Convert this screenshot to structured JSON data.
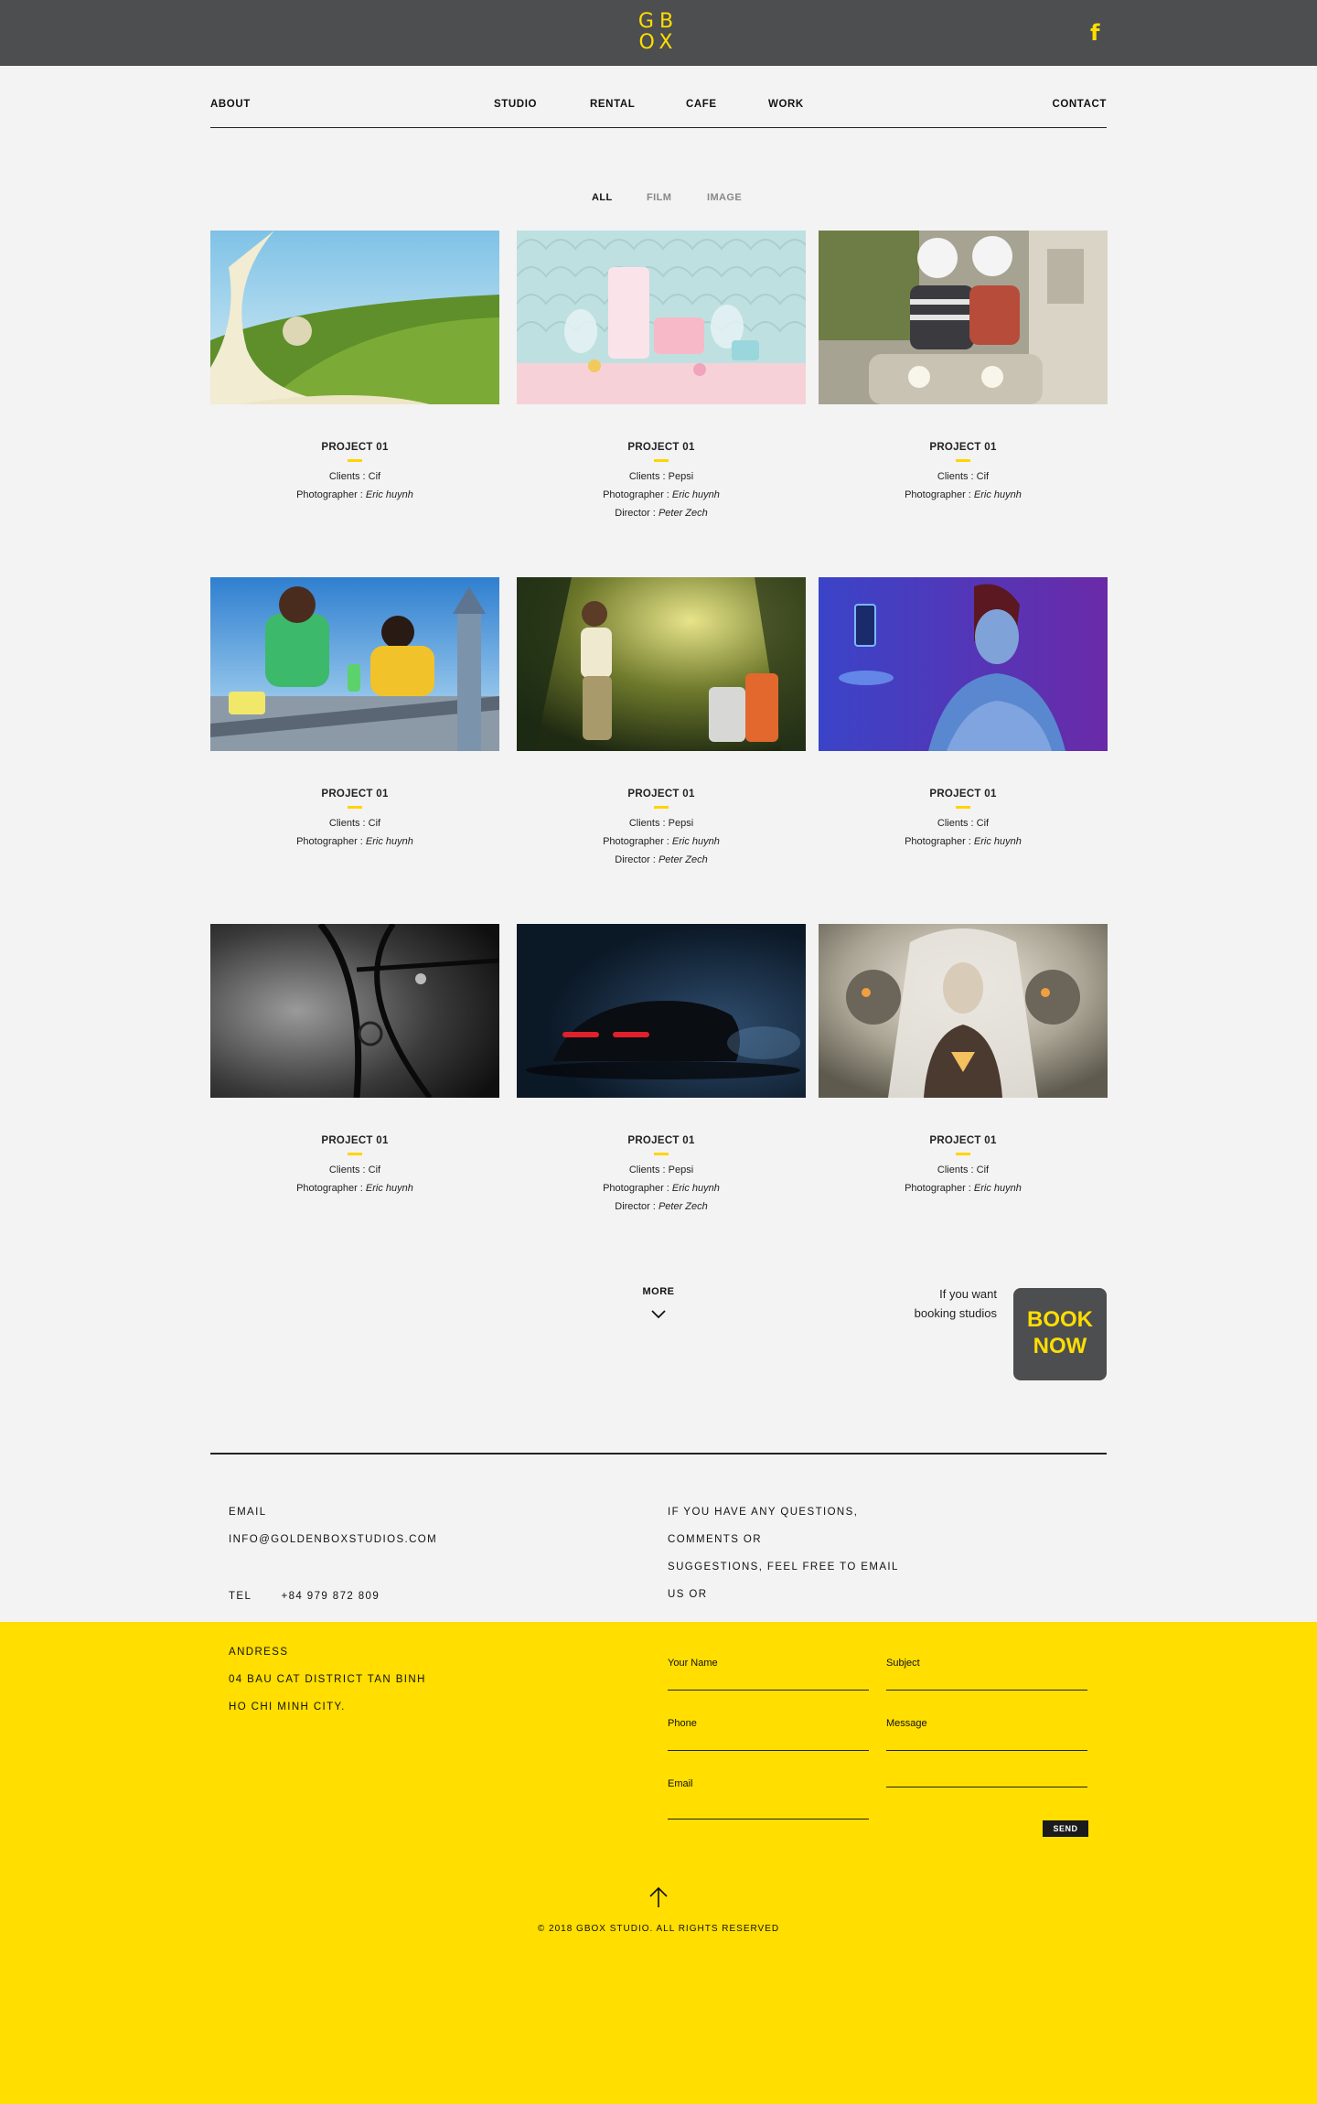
{
  "header": {
    "logo_top": "GB",
    "logo_bottom": "OX",
    "social_icon": "f"
  },
  "nav": {
    "about": "ABOUT",
    "studio": "STUDIO",
    "rental": "RENTAL",
    "cafe": "CAFE",
    "work": "WORK",
    "contact": "CONTACT"
  },
  "filters": {
    "all": "ALL",
    "film": "FILM",
    "image": "IMAGE",
    "active": "ALL"
  },
  "projects": [
    {
      "title": "PROJECT 01",
      "client_label": "Clients : ",
      "client": "Cif",
      "photographer_label": "Photographer : ",
      "photographer": "Eric huynh",
      "image": "milk-splash-tea-field"
    },
    {
      "title": "PROJECT 01",
      "client_label": "Clients : ",
      "client": "Pepsi",
      "photographer_label": "Photographer : ",
      "photographer": "Eric huynh",
      "director_label": "Director : ",
      "director": "Peter Zech",
      "image": "pastel-dessert-table"
    },
    {
      "title": "PROJECT 01",
      "client_label": "Clients : ",
      "client": "Cif",
      "photographer_label": "Photographer : ",
      "photographer": "Eric huynh",
      "image": "couple-on-scooter"
    },
    {
      "title": "PROJECT 01",
      "client_label": "Clients : ",
      "client": "Cif",
      "photographer_label": "Photographer : ",
      "photographer": "Eric huynh",
      "image": "cleaning-city-ad"
    },
    {
      "title": "PROJECT 01",
      "client_label": "Clients : ",
      "client": "Pepsi",
      "photographer_label": "Photographer : ",
      "photographer": "Eric huynh",
      "director_label": "Director : ",
      "director": "Peter Zech",
      "image": "jungle-explorer-luggage"
    },
    {
      "title": "PROJECT 01",
      "client_label": "Clients : ",
      "client": "Cif",
      "photographer_label": "Photographer : ",
      "photographer": "Eric huynh",
      "image": "woman-floating-phone"
    },
    {
      "title": "PROJECT 01",
      "client_label": "Clients : ",
      "client": "Cif",
      "photographer_label": "Photographer : ",
      "photographer": "Eric huynh",
      "image": "bw-harness-skin"
    },
    {
      "title": "PROJECT 01",
      "client_label": "Clients : ",
      "client": "Pepsi",
      "photographer_label": "Photographer : ",
      "photographer": "Eric huynh",
      "director_label": "Director : ",
      "director": "Peter Zech",
      "image": "sports-car-night"
    },
    {
      "title": "PROJECT 01",
      "client_label": "Clients : ",
      "client": "Cif",
      "photographer_label": "Photographer : ",
      "photographer": "Eric huynh",
      "image": "fantasy-queen-skulls"
    }
  ],
  "more": {
    "label": "MORE"
  },
  "booking": {
    "line1": "If you want",
    "line2": "booking studios",
    "btn1": "BOOK",
    "btn2": "NOW"
  },
  "contact_info": {
    "email_label": "EMAIL",
    "email": "INFO@GOLDENBOXSTUDIOS.COM",
    "tel_label": "TEL",
    "tel": "+84 979 872 809",
    "address_label": "ANDRESS",
    "address1": "04 BAU CAT DISTRICT TAN BINH",
    "address2": "HO CHI MINH CITY.",
    "questions": [
      "IF YOU HAVE ANY QUESTIONS,",
      "COMMENTS OR",
      "SUGGESTIONS, FEEL FREE TO EMAIL",
      "US OR"
    ]
  },
  "form": {
    "name": "Your Name",
    "subject": "Subject",
    "phone": "Phone",
    "message": "Message",
    "email": "Email",
    "send": "SEND"
  },
  "footer": {
    "copyright": "© 2018 GBOX STUDIO. ALL RIGHTS RESERVED"
  },
  "colors": {
    "brand_yellow": "#ffde00",
    "dark_gray": "#4d4e50",
    "background": "#f3f3f3"
  }
}
